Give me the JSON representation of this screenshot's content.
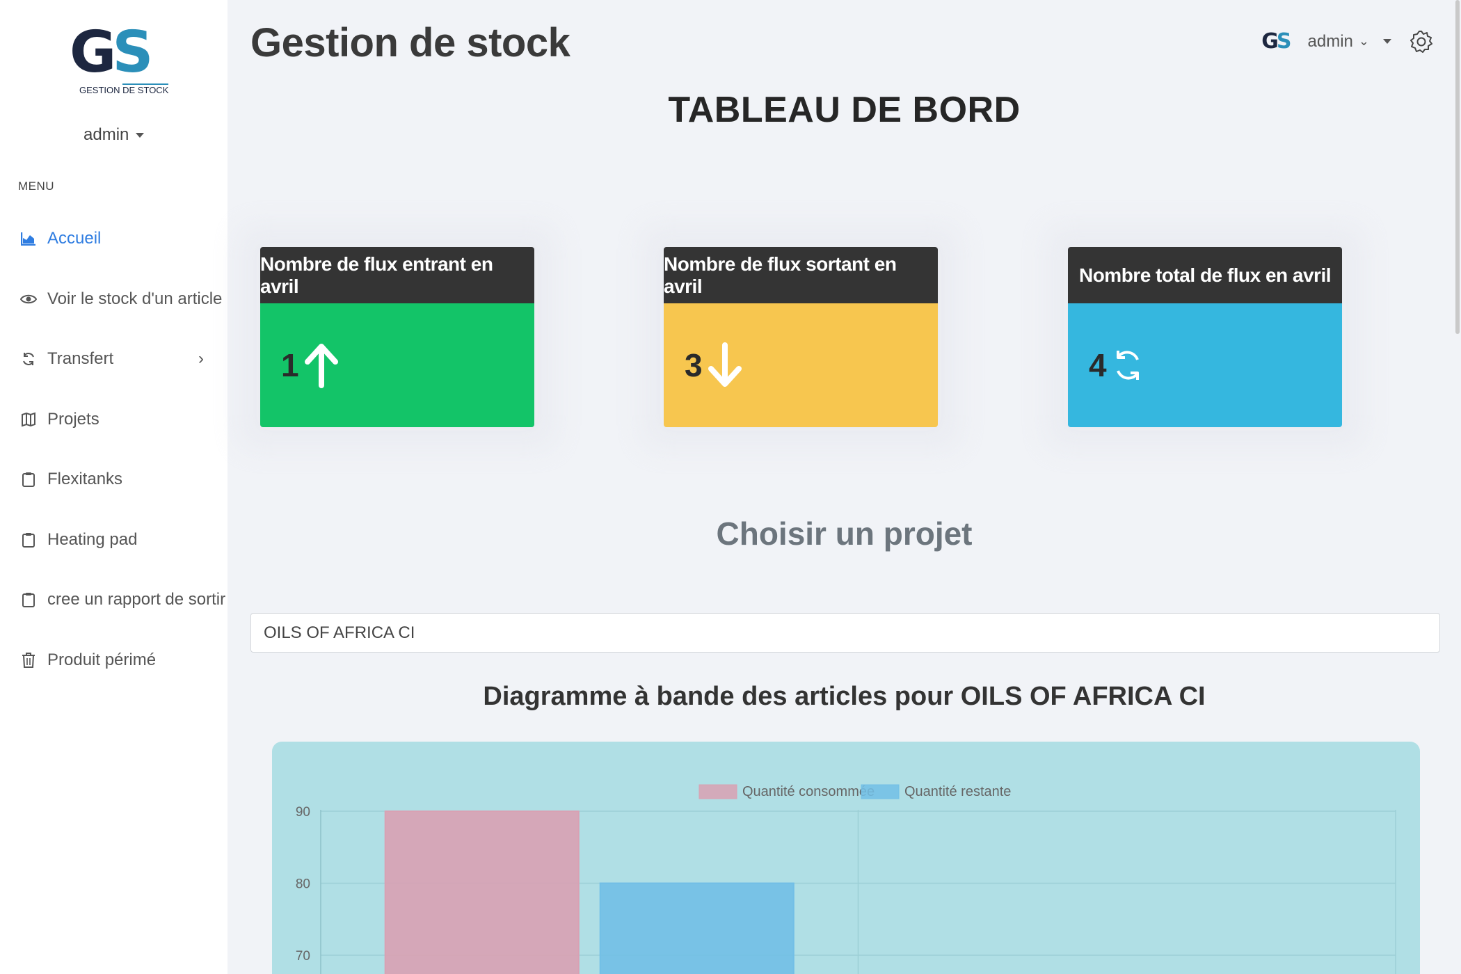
{
  "app": {
    "title": "Gestion de stock",
    "logo_text_g": "G",
    "logo_text_s": "S",
    "logo_sub_1": "GESTION",
    "logo_sub_2": "DE STOCK"
  },
  "user": {
    "name": "admin"
  },
  "sidebar": {
    "menu_title": "MENU",
    "items": [
      {
        "label": "Accueil",
        "icon": "chart-area-icon",
        "active": true
      },
      {
        "label": "Voir le stock d'un article",
        "icon": "eye-icon"
      },
      {
        "label": "Transfert",
        "icon": "sync-icon",
        "has_submenu": true
      },
      {
        "label": "Projets",
        "icon": "map-book-icon"
      },
      {
        "label": "Flexitanks",
        "icon": "clipboard-icon"
      },
      {
        "label": "Heating pad",
        "icon": "clipboard-icon"
      },
      {
        "label": "cree un rapport de sortir",
        "icon": "clipboard-icon"
      },
      {
        "label": "Produit périmé",
        "icon": "trash-icon"
      }
    ]
  },
  "header": {
    "user_label": "admin",
    "user_label_chevron": "⌄"
  },
  "dashboard": {
    "title": "TABLEAU DE BORD",
    "cards": [
      {
        "title": "Nombre de flux entrant en avril",
        "value": "1",
        "icon": "arrow-up-icon",
        "color": "#13c468"
      },
      {
        "title": "Nombre de flux sortant en avril",
        "value": "3",
        "icon": "arrow-down-icon",
        "color": "#f7c64f"
      },
      {
        "title": "Nombre total de flux en avril",
        "value": "4",
        "icon": "sync-icon",
        "color": "#35b7df"
      }
    ],
    "choose_label": "Choisir un projet",
    "project_value": "OILS OF AFRICA CI",
    "chart_heading": "Diagramme à bande des articles pour OILS OF AFRICA CI"
  },
  "chart_data": {
    "type": "bar",
    "categories": [
      "",
      ""
    ],
    "series": [
      {
        "name": "Quantité consommée",
        "values": [
          90,
          null
        ],
        "color": "#d9a1b3"
      },
      {
        "name": "Quantité restante",
        "values": [
          80,
          null
        ],
        "color": "#72bfe6"
      }
    ],
    "yticks": [
      "90",
      "80",
      "70"
    ],
    "ylim_visible": [
      70,
      90
    ],
    "legend": "top-center",
    "grid": true
  }
}
